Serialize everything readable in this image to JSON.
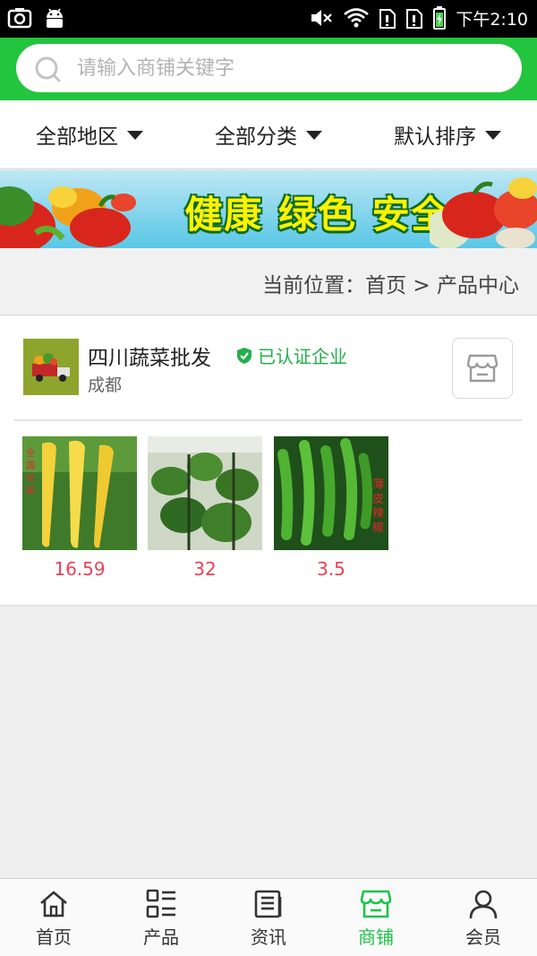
{
  "status_bar": {
    "time": "下午2:10",
    "icons": [
      "screenshot-icon",
      "android-icon",
      "volume-muted-icon",
      "wifi-icon",
      "sim1-icon",
      "sim2-icon",
      "battery-icon"
    ]
  },
  "search": {
    "placeholder": "请输入商铺关键字",
    "value": ""
  },
  "filters": [
    {
      "label": "全部地区"
    },
    {
      "label": "全部分类"
    },
    {
      "label": "默认排序"
    }
  ],
  "banner": {
    "slogan": "健康 绿色 安全"
  },
  "breadcrumb": {
    "text": "当前位置：首页 > 产品中心"
  },
  "store": {
    "name": "四川蔬菜批发",
    "verified_label": "已认证企业",
    "city": "成都",
    "products": [
      {
        "price": "16.59",
        "image": "yellow-carrots",
        "overlay_text": "全国包邮"
      },
      {
        "price": "32",
        "image": "green-bean-plants",
        "overlay_text": ""
      },
      {
        "price": "3.5",
        "image": "green-chili-peppers",
        "overlay_text": "薄皮辣椒"
      }
    ]
  },
  "bottom_nav": [
    {
      "label": "首页",
      "icon": "home-icon",
      "active": false
    },
    {
      "label": "产品",
      "icon": "grid-list-icon",
      "active": false
    },
    {
      "label": "资讯",
      "icon": "news-icon",
      "active": false
    },
    {
      "label": "商铺",
      "icon": "store-icon",
      "active": true
    },
    {
      "label": "会员",
      "icon": "user-icon",
      "active": false
    }
  ],
  "colors": {
    "brand_green": "#22c53d",
    "active_nav": "#1ec44a",
    "price_red": "#ee4055",
    "verified_green": "#22b04a"
  }
}
